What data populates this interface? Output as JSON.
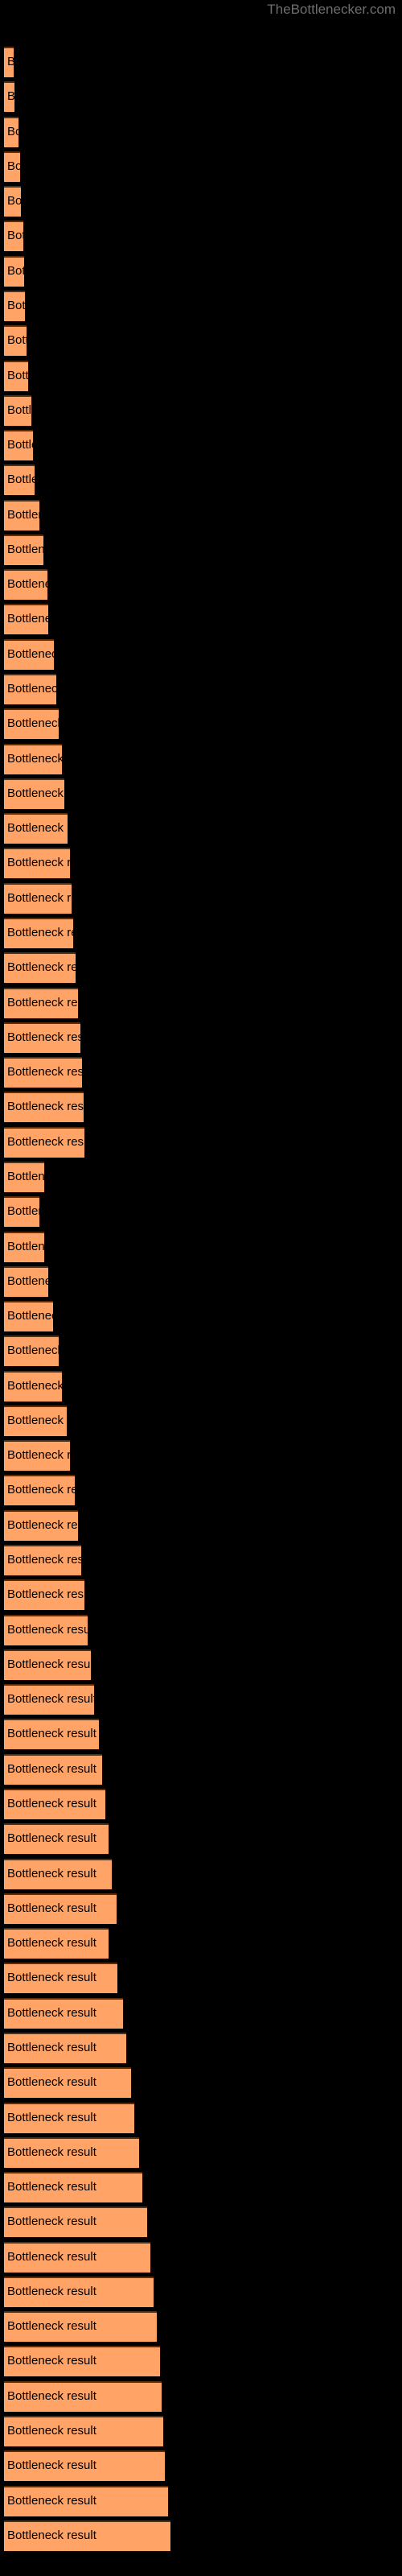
{
  "watermark": "TheBottlenecker.com",
  "colors": {
    "background": "#000000",
    "bar_fill": "#ffa366",
    "bar_border_top": "#5a2d0c",
    "label_text": "#000000",
    "watermark_text": "#6e6e6e"
  },
  "chart_data": {
    "type": "bar",
    "orientation": "horizontal",
    "title": "",
    "subtitle": "",
    "xlabel": "",
    "ylabel": "",
    "grid": false,
    "legend": null,
    "axis_visible": false,
    "tick_labels_visible": false,
    "bar_label_text": "Bottleneck result",
    "xlim": [
      0,
      230
    ],
    "categories": [
      "Bottleneck result",
      "Bottleneck result",
      "Bottleneck result",
      "Bottleneck result",
      "Bottleneck result",
      "Bottleneck result",
      "Bottleneck result",
      "Bottleneck result",
      "Bottleneck result",
      "Bottleneck result",
      "Bottleneck result",
      "Bottleneck result",
      "Bottleneck result",
      "Bottleneck result",
      "Bottleneck result",
      "Bottleneck result",
      "Bottleneck result",
      "Bottleneck result",
      "Bottleneck result",
      "Bottleneck result",
      "Bottleneck result",
      "Bottleneck result",
      "Bottleneck result",
      "Bottleneck result",
      "Bottleneck result",
      "Bottleneck result",
      "Bottleneck result",
      "Bottleneck result",
      "Bottleneck result",
      "Bottleneck result",
      "Bottleneck result",
      "Bottleneck result",
      "Bottleneck result",
      "Bottleneck result",
      "Bottleneck result",
      "Bottleneck result",
      "Bottleneck result",
      "Bottleneck result",
      "Bottleneck result",
      "Bottleneck result",
      "Bottleneck result",
      "Bottleneck result",
      "Bottleneck result",
      "Bottleneck result",
      "Bottleneck result",
      "Bottleneck result",
      "Bottleneck result",
      "Bottleneck result",
      "Bottleneck result",
      "Bottleneck result",
      "Bottleneck result",
      "Bottleneck result",
      "Bottleneck result",
      "Bottleneck result",
      "Bottleneck result",
      "Bottleneck result",
      "Bottleneck result",
      "Bottleneck result",
      "Bottleneck result",
      "Bottleneck result",
      "Bottleneck result",
      "Bottleneck result",
      "Bottleneck result",
      "Bottleneck result",
      "Bottleneck result",
      "Bottleneck result",
      "Bottleneck result",
      "Bottleneck result",
      "Bottleneck result",
      "Bottleneck result",
      "Bottleneck result",
      "Bottleneck result"
    ],
    "values": [
      12,
      13,
      18,
      20,
      21,
      24,
      25,
      26,
      28,
      30,
      34,
      36,
      38,
      44,
      49,
      54,
      55,
      62,
      65,
      68,
      72,
      75,
      79,
      82,
      84,
      86,
      89,
      92,
      95,
      97,
      99,
      100,
      50,
      44,
      50,
      55,
      61,
      68,
      72,
      78,
      82,
      88,
      92,
      96,
      100,
      104,
      108,
      112,
      118,
      122,
      126,
      130,
      134,
      140,
      130,
      141,
      148,
      152,
      158,
      162,
      168,
      172,
      178,
      182,
      186,
      190,
      194,
      196,
      198,
      200,
      204,
      207
    ]
  }
}
